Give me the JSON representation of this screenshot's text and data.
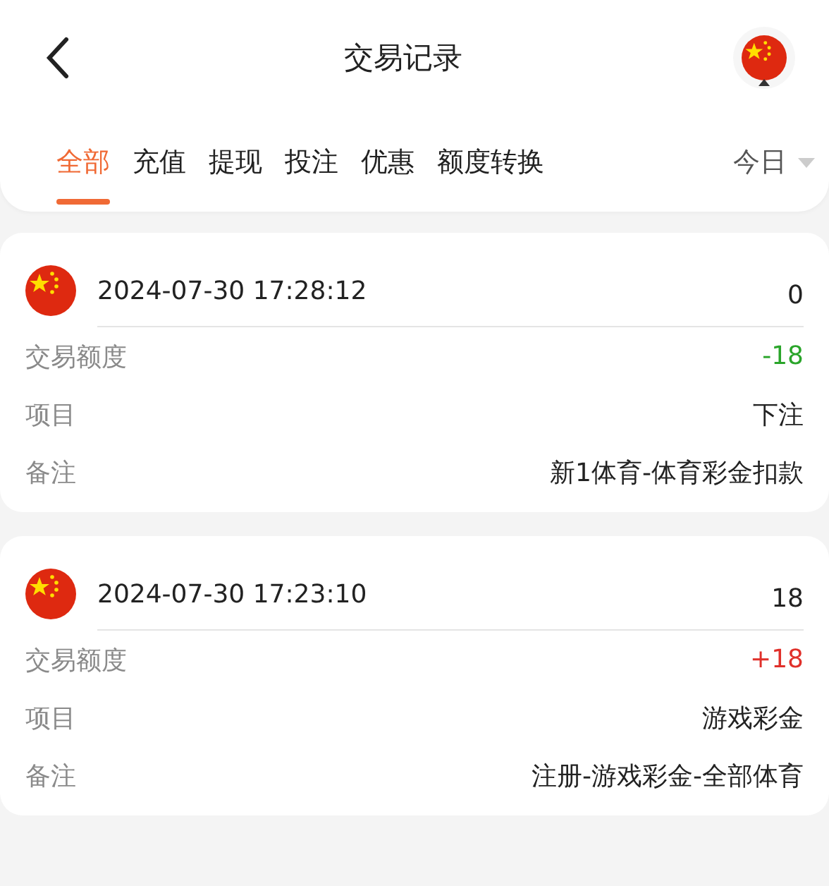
{
  "header": {
    "title": "交易记录"
  },
  "tabs": [
    {
      "label": "全部",
      "selected": true
    },
    {
      "label": "充值",
      "selected": false
    },
    {
      "label": "提现",
      "selected": false
    },
    {
      "label": "投注",
      "selected": false
    },
    {
      "label": "优惠",
      "selected": false
    },
    {
      "label": "额度转换",
      "selected": false
    }
  ],
  "date_filter": {
    "label": "今日"
  },
  "records": [
    {
      "time": "2024-07-30 17:28:12",
      "balance": "0",
      "fields": [
        {
          "label": "交易额度",
          "value": "-18",
          "color": "#2aa52a"
        },
        {
          "label": "项目",
          "value": "下注"
        },
        {
          "label": "备注",
          "value": "新1体育-体育彩金扣款"
        }
      ]
    },
    {
      "time": "2024-07-30 17:23:10",
      "balance": "18",
      "fields": [
        {
          "label": "交易额度",
          "value": "+18",
          "color": "#e0302a"
        },
        {
          "label": "项目",
          "value": "游戏彩金"
        },
        {
          "label": "备注",
          "value": "注册-游戏彩金-全部体育"
        }
      ]
    }
  ]
}
